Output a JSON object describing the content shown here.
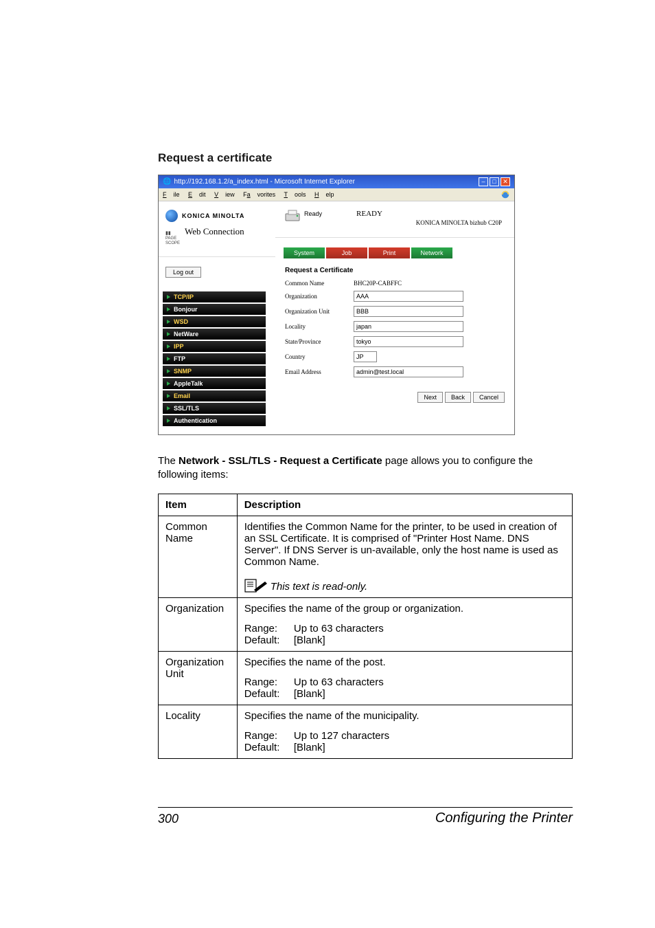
{
  "section_heading": "Request a certificate",
  "browser": {
    "title": "http://192.168.1.2/a_index.html - Microsoft Internet Explorer",
    "menus": [
      "File",
      "Edit",
      "View",
      "Favorites",
      "Tools",
      "Help"
    ],
    "brand_name": "KONICA MINOLTA",
    "pagescope_small": "PAGE\nSCOPE",
    "web_connection": "Web Connection",
    "logout": "Log out",
    "status_small": "Ready",
    "status_big": "READY",
    "model": "KONICA MINOLTA bizhub C20P",
    "tabs": [
      "System",
      "Job",
      "Print",
      "Network"
    ],
    "sidenav": [
      {
        "label": "TCP/IP",
        "active": true
      },
      {
        "label": "Bonjour",
        "active": false
      },
      {
        "label": "WSD",
        "active": true
      },
      {
        "label": "NetWare",
        "active": false
      },
      {
        "label": "IPP",
        "active": true
      },
      {
        "label": "FTP",
        "active": false
      },
      {
        "label": "SNMP",
        "active": true
      },
      {
        "label": "AppleTalk",
        "active": false
      },
      {
        "label": "Email",
        "active": true
      },
      {
        "label": "SSL/TLS",
        "active": false
      },
      {
        "label": "Authentication",
        "active": false
      }
    ],
    "form": {
      "title": "Request a Certificate",
      "fields": [
        {
          "label": "Common Name",
          "value": "BHC20P-CABFFC",
          "readonly": true,
          "short": false
        },
        {
          "label": "Organization",
          "value": "AAA",
          "readonly": false,
          "short": false
        },
        {
          "label": "Organization Unit",
          "value": "BBB",
          "readonly": false,
          "short": false
        },
        {
          "label": "Locality",
          "value": "japan",
          "readonly": false,
          "short": false
        },
        {
          "label": "State/Province",
          "value": "tokyo",
          "readonly": false,
          "short": false
        },
        {
          "label": "Country",
          "value": "JP",
          "readonly": false,
          "short": true
        },
        {
          "label": "Email Address",
          "value": "admin@test.local",
          "readonly": false,
          "short": false
        }
      ],
      "buttons": [
        "Next",
        "Back",
        "Cancel"
      ]
    }
  },
  "main_text": {
    "pre": "The ",
    "bold": "Network - SSL/TLS - Request a Certificate",
    "post": " page allows you to configure the following items:"
  },
  "table": {
    "headers": [
      "Item",
      "Description"
    ],
    "rows": [
      {
        "item": "Common Name",
        "desc": "Identifies the Common Name for the printer, to be used in creation of an SSL Certificate. It is comprised of \"Printer Host Name. DNS Server\". If DNS Server is un-available, only the host name is used as Common Name.",
        "note": "This text is read-only."
      },
      {
        "item": "Organization",
        "desc": "Specifies the name of the group or organization.",
        "range": "Up to 63 characters",
        "default": "[Blank]"
      },
      {
        "item": "Organization Unit",
        "desc": "Specifies the name of the post.",
        "range": "Up to 63 characters",
        "default": "[Blank]"
      },
      {
        "item": "Locality",
        "desc": "Specifies the name of the municipality.",
        "range": "Up to 127 characters",
        "default": "[Blank]"
      }
    ],
    "labels": {
      "range": "Range:",
      "default": "Default:"
    }
  },
  "footer": {
    "page": "300",
    "title": "Configuring the Printer"
  }
}
